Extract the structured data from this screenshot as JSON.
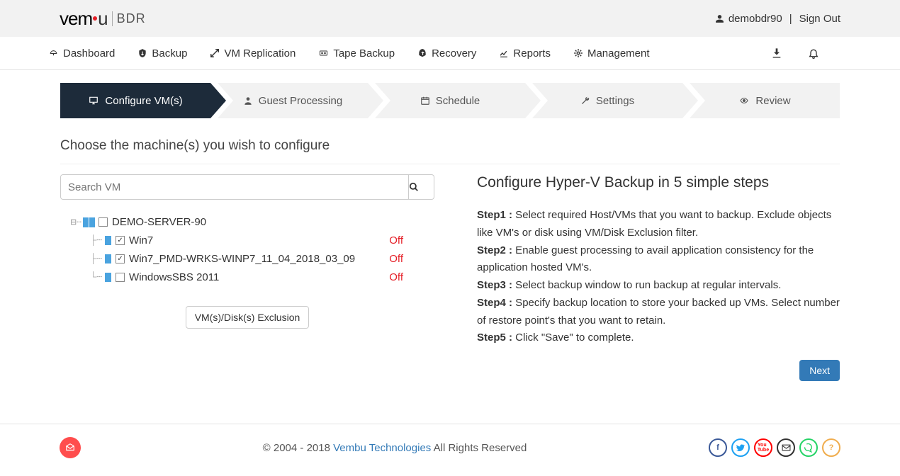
{
  "header": {
    "brand_a": "vem",
    "brand_b": "u",
    "bdr": "BDR",
    "username": "demobdr90",
    "signout": "Sign Out"
  },
  "nav": {
    "items": [
      {
        "label": "Dashboard"
      },
      {
        "label": "Backup"
      },
      {
        "label": "VM Replication"
      },
      {
        "label": "Tape Backup"
      },
      {
        "label": "Recovery"
      },
      {
        "label": "Reports"
      },
      {
        "label": "Management"
      }
    ]
  },
  "wizard": {
    "steps": [
      {
        "label": "Configure VM(s)",
        "icon": "desktop",
        "active": true
      },
      {
        "label": "Guest Processing",
        "icon": "user"
      },
      {
        "label": "Schedule",
        "icon": "calendar"
      },
      {
        "label": "Settings",
        "icon": "wrench"
      },
      {
        "label": "Review",
        "icon": "eye"
      }
    ]
  },
  "page": {
    "heading": "Choose the machine(s) you wish to configure",
    "search_placeholder": "Search VM",
    "exclusion_btn": "VM(s)/Disk(s) Exclusion",
    "next": "Next"
  },
  "tree": {
    "server": "DEMO-SERVER-90",
    "vms": [
      {
        "name": "Win7",
        "checked": true,
        "status": "Off"
      },
      {
        "name": "Win7_PMD-WRKS-WINP7_11_04_2018_03_09",
        "checked": true,
        "status": "Off"
      },
      {
        "name": "WindowsSBS 2011",
        "checked": false,
        "status": "Off"
      }
    ]
  },
  "help": {
    "title": "Configure Hyper-V Backup in 5 simple steps",
    "items": [
      {
        "h": "Step1 :",
        "t": " Select required Host/VMs that you want to backup. Exclude objects like VM's or disk using VM/Disk Exclusion filter."
      },
      {
        "h": "Step2 :",
        "t": " Enable guest processing to avail application consistency for the application hosted VM's."
      },
      {
        "h": "Step3 :",
        "t": " Select backup window to run backup at regular intervals."
      },
      {
        "h": "Step4 :",
        "t": " Specify backup location to store your backed up VMs. Select number of restore point's that you want to retain."
      },
      {
        "h": "Step5 :",
        "t": " Click \"Save\" to complete."
      }
    ]
  },
  "footer": {
    "copyright_a": "2004 - 2018 ",
    "company": "Vembu Technologies",
    "copyright_b": " All Rights Reserved"
  }
}
